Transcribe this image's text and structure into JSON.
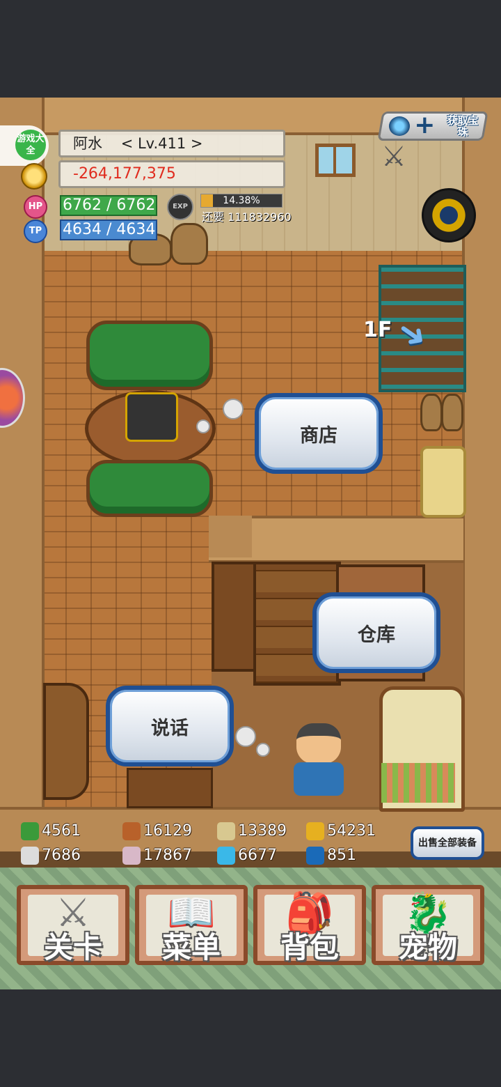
{
  "player": {
    "name": "阿水",
    "level": "< Lv.411 >",
    "gold": "-264,177,375",
    "hp": "6762 / 6762",
    "tp": "4634 / 4634",
    "hp_label": "HP",
    "tp_label": "TP",
    "exp_label": "EXP",
    "exp_percent_text": "14.38%",
    "exp_fraction": 0.1438,
    "exp_remaining": "还要 111832960"
  },
  "logo": {
    "text": "游戏大全"
  },
  "top_right": {
    "gem_button_label": "获取宝珠"
  },
  "map": {
    "floor_label": "1F"
  },
  "actions": {
    "shop": "商店",
    "warehouse": "仓库",
    "talk": "说话"
  },
  "resources": [
    {
      "icon": "herb-icon",
      "value": "4561",
      "color": "#3a9a3a"
    },
    {
      "icon": "wood-log-icon",
      "value": "16129",
      "color": "#b8612a"
    },
    {
      "icon": "scroll-icon",
      "value": "13389",
      "color": "#d8c890"
    },
    {
      "icon": "gold-drop-icon",
      "value": "54231",
      "color": "#e6b020"
    },
    {
      "icon": "iron-ingot-icon",
      "value": "7686",
      "color": "#dcdcdc"
    },
    {
      "icon": "ore-stone-icon",
      "value": "17867",
      "color": "#d8b8c8"
    },
    {
      "icon": "blue-flame-icon",
      "value": "6677",
      "color": "#3ab8e8"
    },
    {
      "icon": "blue-orb-icon",
      "value": "851",
      "color": "#1a6ab8"
    }
  ],
  "sell_all_label": "出售全部装备",
  "menu": [
    {
      "icon": "crossed-swords-icon",
      "label": "关卡"
    },
    {
      "icon": "book-icon",
      "label": "菜单"
    },
    {
      "icon": "backpack-icon",
      "label": "背包"
    },
    {
      "icon": "dragon-icon",
      "label": "宠物"
    }
  ]
}
